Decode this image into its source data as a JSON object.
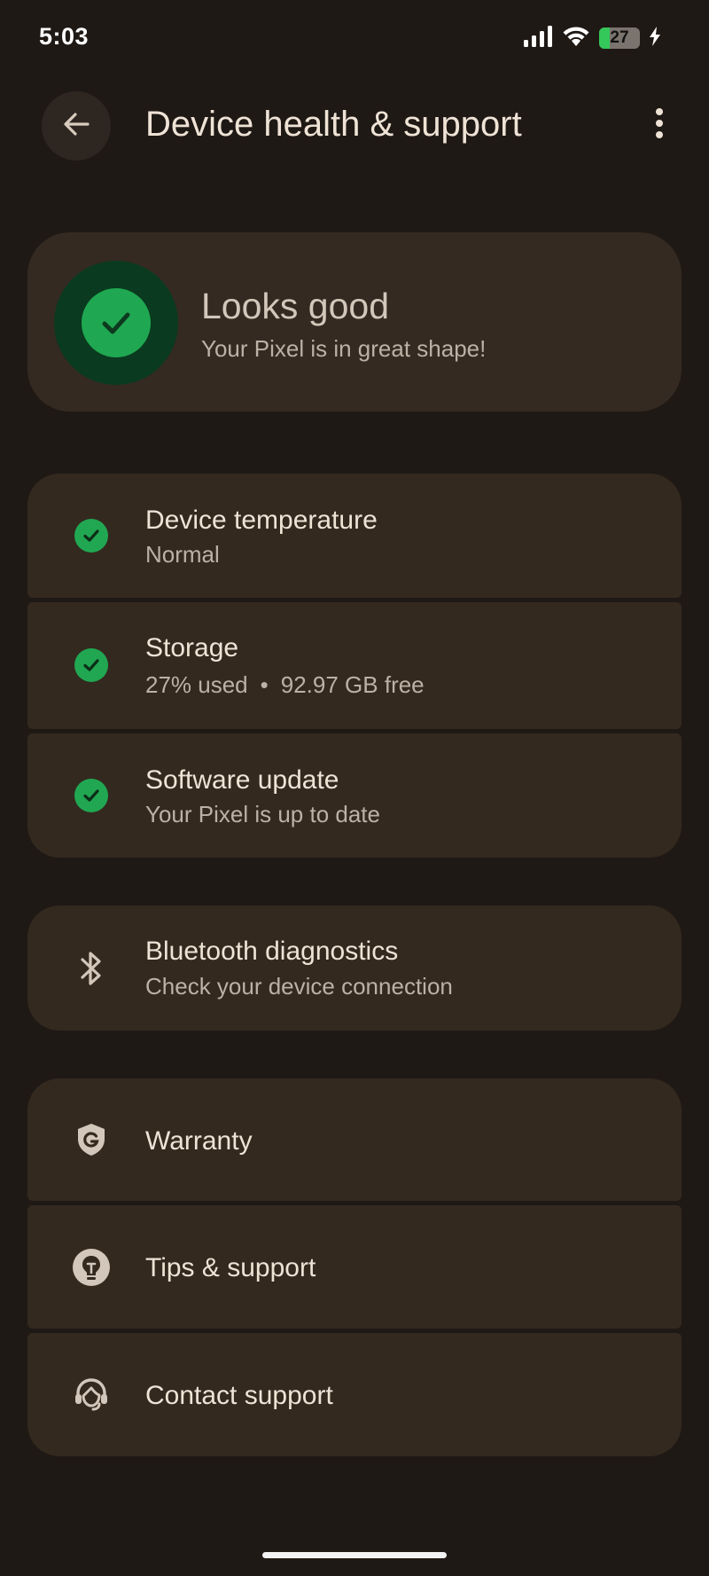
{
  "status_bar": {
    "time": "5:03",
    "battery_level": "27",
    "battery_fraction": 0.27,
    "battery_color": "#34c759",
    "icons": [
      "signal-icon",
      "wifi-icon",
      "battery-icon",
      "charging-bolt-icon"
    ]
  },
  "app_bar": {
    "back_icon": "arrow-left-icon",
    "title": "Device health & support",
    "more_icon": "more-vert-icon"
  },
  "summary": {
    "icon": "check-circle-icon",
    "title": "Looks good",
    "subtitle": "Your Pixel is in great shape!"
  },
  "health_items": [
    {
      "icon": "check-circle-icon",
      "title": "Device temperature",
      "subtitle": "Normal"
    },
    {
      "icon": "check-circle-icon",
      "title": "Storage",
      "subtitle_used": "27% used",
      "subtitle_separator": "•",
      "subtitle_free": "92.97 GB free"
    },
    {
      "icon": "check-circle-icon",
      "title": "Software update",
      "subtitle": "Your Pixel is up to date"
    }
  ],
  "bluetooth": {
    "icon": "bluetooth-icon",
    "title": "Bluetooth diagnostics",
    "subtitle": "Check your device connection"
  },
  "support_items": [
    {
      "icon": "warranty-shield-icon",
      "title": "Warranty"
    },
    {
      "icon": "tips-lightbulb-icon",
      "title": "Tips & support"
    },
    {
      "icon": "headset-agent-icon",
      "title": "Contact support"
    }
  ],
  "colors": {
    "background": "#1f1915",
    "card": "#33291f",
    "success": "#21a752",
    "success_ring": "#0a3a1f"
  }
}
